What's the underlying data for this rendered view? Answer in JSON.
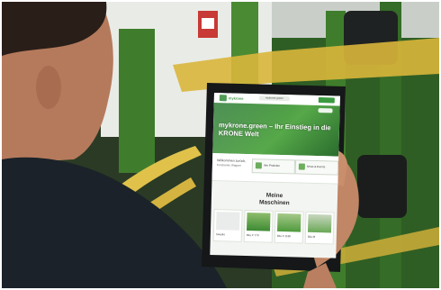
{
  "scene": {
    "subject": "person-holding-tablet",
    "colors": {
      "machine_green": "#3f7d2c",
      "machine_yellow": "#d9b63b",
      "wall": "#e9ebe6",
      "skin": "#b57a5c",
      "shirt": "#1b2229"
    }
  },
  "tablet_screen": {
    "header": {
      "brand": "mykrone",
      "url": "mykrone.green"
    },
    "hero": {
      "headline": "mykrone.green – Ihr Einstieg in die KRONE Welt"
    },
    "welcome": {
      "line1": "Willkommen zurück,",
      "line2": "Konstantin Wagner",
      "box1_label": "Ihre Produkte",
      "box2_label": "News & Events"
    },
    "machines": {
      "title_line1": "Meine",
      "title_line2": "Maschinen",
      "cards": [
        {
          "caption": "Swadro"
        },
        {
          "caption": "BiG X 770"
        },
        {
          "caption": "BiG X 1180"
        },
        {
          "caption": "BiG M"
        }
      ]
    }
  }
}
